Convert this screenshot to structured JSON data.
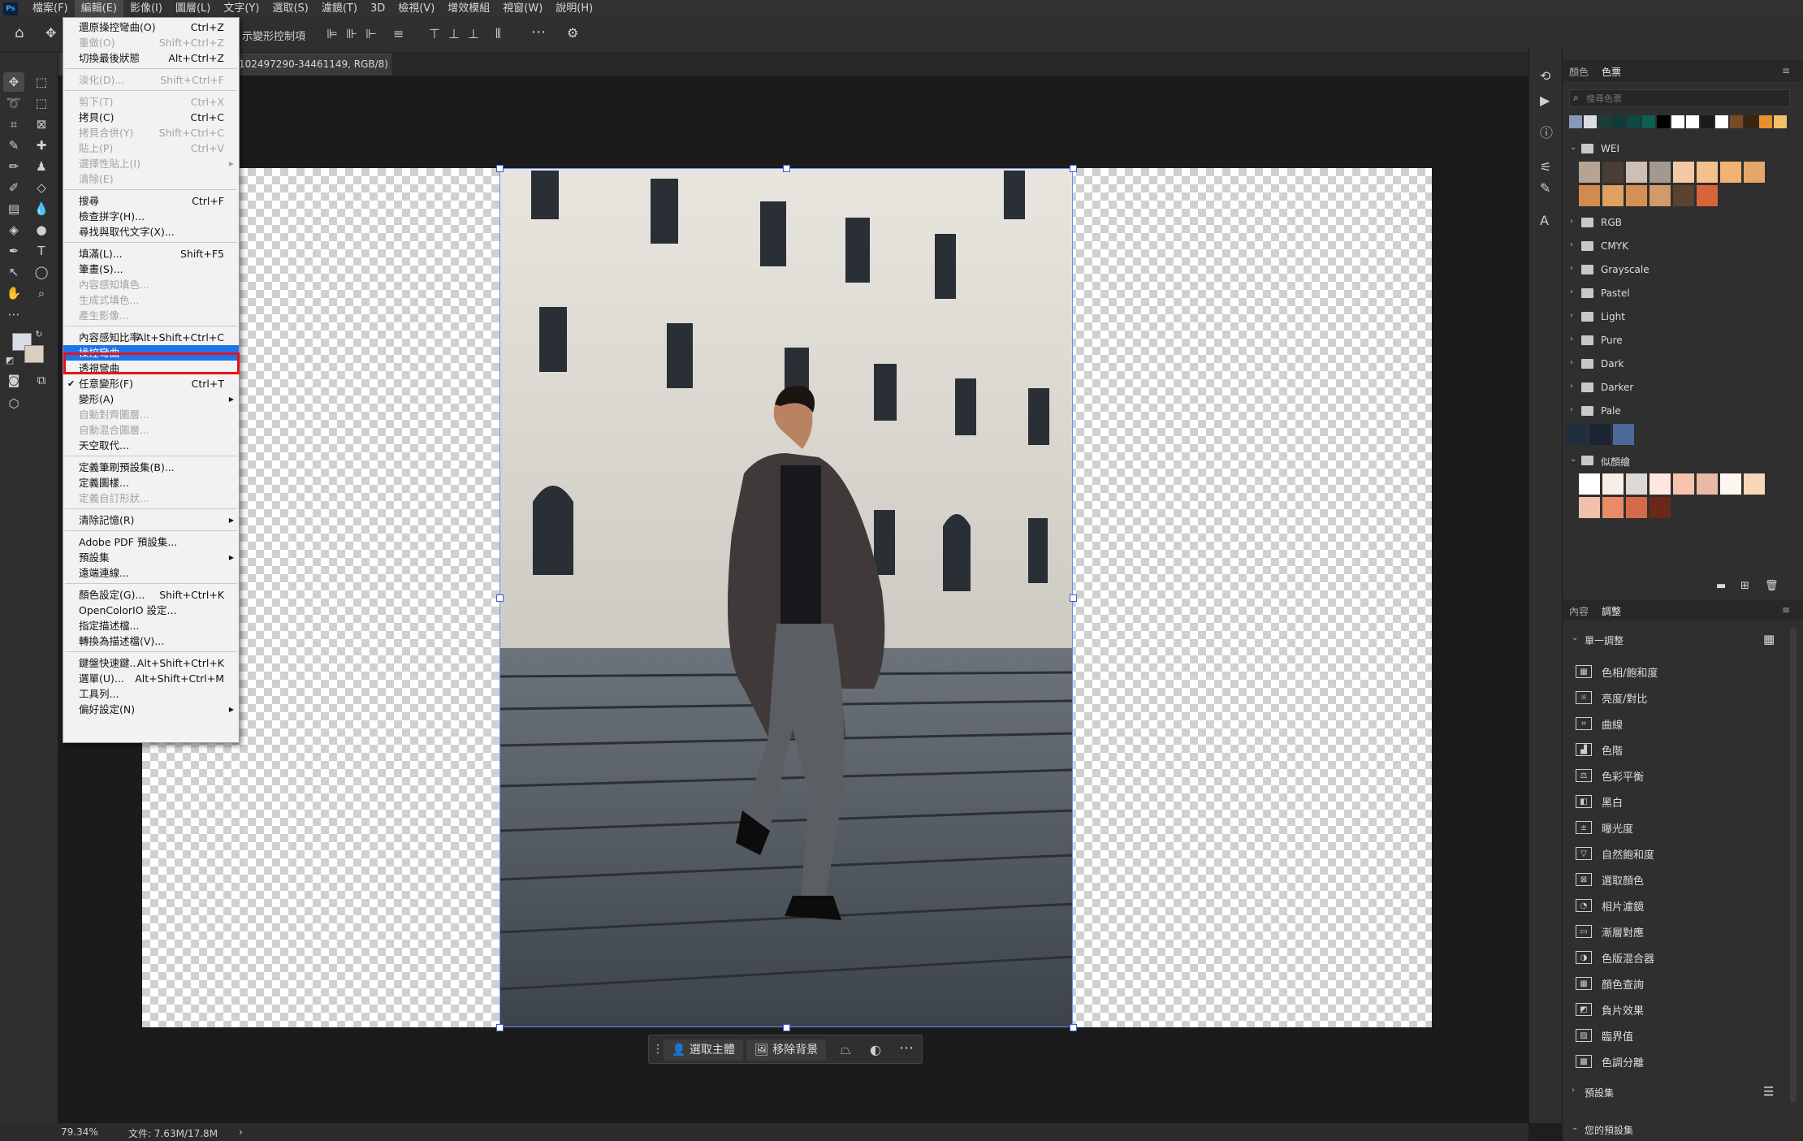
{
  "menubar": {
    "items": [
      "檔案(F)",
      "編輯(E)",
      "影像(I)",
      "圖層(L)",
      "文字(Y)",
      "選取(S)",
      "濾鏡(T)",
      "3D",
      "檢視(V)",
      "增效模組",
      "視窗(W)",
      "說明(H)"
    ],
    "active_index": 1
  },
  "optionsbar": {
    "transform_label": "示變形控制項"
  },
  "document_tab": {
    "title": "102497290-34461149, RGB/8) *",
    "close": "×"
  },
  "edit_menu": [
    {
      "label": "還原操控彎曲(O)",
      "shortcut": "Ctrl+Z",
      "disabled": false
    },
    {
      "label": "重做(O)",
      "shortcut": "Shift+Ctrl+Z",
      "disabled": true
    },
    {
      "label": "切換最後狀態",
      "shortcut": "Alt+Ctrl+Z",
      "disabled": false
    },
    {
      "sep": true
    },
    {
      "label": "淡化(D)...",
      "shortcut": "Shift+Ctrl+F",
      "disabled": true
    },
    {
      "sep": true
    },
    {
      "label": "剪下(T)",
      "shortcut": "Ctrl+X",
      "disabled": true
    },
    {
      "label": "拷貝(C)",
      "shortcut": "Ctrl+C",
      "disabled": false
    },
    {
      "label": "拷貝合併(Y)",
      "shortcut": "Shift+Ctrl+C",
      "disabled": true
    },
    {
      "label": "貼上(P)",
      "shortcut": "Ctrl+V",
      "disabled": true
    },
    {
      "label": "選擇性貼上(I)",
      "shortcut": "",
      "disabled": true,
      "submenu": true
    },
    {
      "label": "清除(E)",
      "shortcut": "",
      "disabled": true
    },
    {
      "sep": true
    },
    {
      "label": "搜尋",
      "shortcut": "Ctrl+F",
      "disabled": false
    },
    {
      "label": "檢查拼字(H)...",
      "shortcut": "",
      "disabled": false
    },
    {
      "label": "尋找與取代文字(X)...",
      "shortcut": "",
      "disabled": false
    },
    {
      "sep": true
    },
    {
      "label": "填滿(L)...",
      "shortcut": "Shift+F5",
      "disabled": false
    },
    {
      "label": "筆畫(S)...",
      "shortcut": "",
      "disabled": false
    },
    {
      "label": "內容感知填色...",
      "shortcut": "",
      "disabled": true
    },
    {
      "label": "生成式填色...",
      "shortcut": "",
      "disabled": true
    },
    {
      "label": "產生影像...",
      "shortcut": "",
      "disabled": true
    },
    {
      "sep": true
    },
    {
      "label": "內容感知比率",
      "shortcut": "Alt+Shift+Ctrl+C",
      "disabled": false
    },
    {
      "label": "操控彎曲",
      "shortcut": "",
      "disabled": false,
      "highlight": true
    },
    {
      "label": "透視彎曲",
      "shortcut": "",
      "disabled": false
    },
    {
      "label": "任意變形(F)",
      "shortcut": "Ctrl+T",
      "disabled": false,
      "check": true
    },
    {
      "label": "變形(A)",
      "shortcut": "",
      "disabled": false,
      "submenu": true
    },
    {
      "label": "自動對齊圖層...",
      "shortcut": "",
      "disabled": true
    },
    {
      "label": "自動混合圖層...",
      "shortcut": "",
      "disabled": true
    },
    {
      "label": "天空取代...",
      "shortcut": "",
      "disabled": false
    },
    {
      "sep": true
    },
    {
      "label": "定義筆刷預設集(B)...",
      "shortcut": "",
      "disabled": false
    },
    {
      "label": "定義圖樣...",
      "shortcut": "",
      "disabled": false
    },
    {
      "label": "定義自訂形狀...",
      "shortcut": "",
      "disabled": true
    },
    {
      "sep": true
    },
    {
      "label": "清除記憶(R)",
      "shortcut": "",
      "disabled": false,
      "submenu": true
    },
    {
      "sep": true
    },
    {
      "label": "Adobe PDF 預設集...",
      "shortcut": "",
      "disabled": false
    },
    {
      "label": "預設集",
      "shortcut": "",
      "disabled": false,
      "submenu": true
    },
    {
      "label": "遠端連線...",
      "shortcut": "",
      "disabled": false
    },
    {
      "sep": true
    },
    {
      "label": "顏色設定(G)...",
      "shortcut": "Shift+Ctrl+K",
      "disabled": false
    },
    {
      "label": "OpenColorIO 設定...",
      "shortcut": "",
      "disabled": false
    },
    {
      "label": "指定描述檔...",
      "shortcut": "",
      "disabled": false
    },
    {
      "label": "轉換為描述檔(V)...",
      "shortcut": "",
      "disabled": false
    },
    {
      "sep": true
    },
    {
      "label": "鍵盤快速鍵...",
      "shortcut": "Alt+Shift+Ctrl+K",
      "disabled": false
    },
    {
      "label": "選單(U)...",
      "shortcut": "Alt+Shift+Ctrl+M",
      "disabled": false
    },
    {
      "label": "工具列...",
      "shortcut": "",
      "disabled": false
    },
    {
      "label": "偏好設定(N)",
      "shortcut": "",
      "disabled": false,
      "submenu": true
    }
  ],
  "context_bar": {
    "select_subject": "選取主體",
    "remove_bg": "移除背景"
  },
  "status": {
    "zoom": "79.34%",
    "doc": "文件: 7.63M/17.8M"
  },
  "swatches_panel": {
    "tabs": [
      "顏色",
      "色票"
    ],
    "search_placeholder": "搜尋色票",
    "recent": [
      "#8797b5",
      "#d9dde6",
      "#1a3d3a",
      "#0f3b38",
      "#0d4a44",
      "#0e5e55",
      "#000000",
      "#ffffff",
      "#ffffff",
      "#1a1a1a",
      "#ffffff",
      "#7a4a22",
      "#3a2412",
      "#e8902a",
      "#f0c06a"
    ],
    "groups": [
      {
        "name": "WEI",
        "open": true,
        "colors": [
          "#b6a391",
          "#4a3c36",
          "#cdbfb4",
          "#a29a92",
          "#f3c9a3",
          "#f3c08e",
          "#f1b273",
          "#e4a66a",
          "#d18a4f",
          "#e0a05e",
          "#d59152",
          "#d09a6a",
          "#5a4230",
          "#d8643a"
        ]
      },
      {
        "name": "RGB",
        "open": false
      },
      {
        "name": "CMYK",
        "open": false
      },
      {
        "name": "Grayscale",
        "open": false
      },
      {
        "name": "Pastel",
        "open": false
      },
      {
        "name": "Light",
        "open": false
      },
      {
        "name": "Pure",
        "open": false
      },
      {
        "name": "Dark",
        "open": false
      },
      {
        "name": "Darker",
        "open": false
      },
      {
        "name": "Pale",
        "open": false
      }
    ],
    "loose": [
      "#1f2d3d",
      "#1b2533",
      "#4b6a9a"
    ],
    "skin_group": {
      "name": "似顏繪",
      "open": true,
      "colors": [
        "#ffffff",
        "#f7eee7",
        "#dcd8d6",
        "#fce8de",
        "#f6c3ac",
        "#eab8a4",
        "#fef6ee",
        "#f8d6b8",
        "#f2c1ae",
        "#ea8b68",
        "#d56a4b",
        "#6b2717"
      ]
    }
  },
  "adjust_panel": {
    "tabs": [
      "內容",
      "調整"
    ],
    "section": "單一調整",
    "items": [
      "色相/飽和度",
      "亮度/對比",
      "曲線",
      "色階",
      "色彩平衡",
      "黑白",
      "曝光度",
      "自然飽和度",
      "選取顏色",
      "相片濾鏡",
      "漸層對應",
      "色版混合器",
      "顏色查詢",
      "負片效果",
      "臨界值",
      "色調分離"
    ],
    "presets": "預設集",
    "my_presets": "您的預設集"
  }
}
